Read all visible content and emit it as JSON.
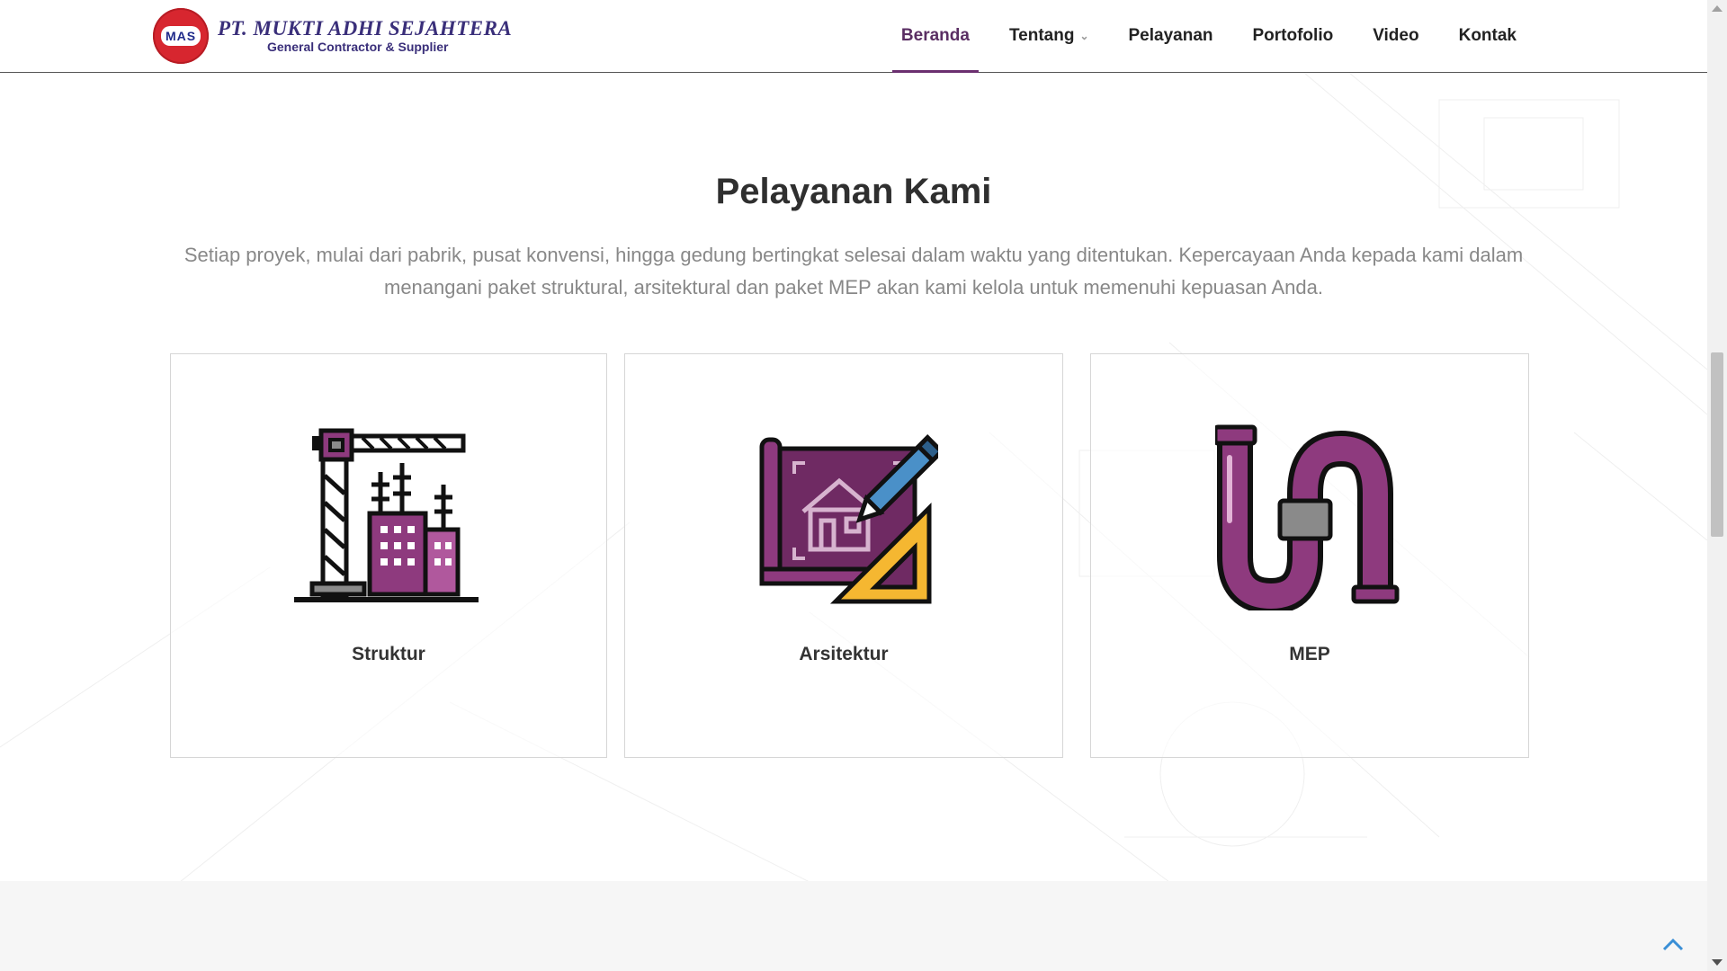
{
  "header": {
    "logo_badge": "MAS",
    "company_name": "PT. MUKTI ADHI SEJAHTERA",
    "tagline": "General Contractor & Supplier",
    "nav": [
      {
        "label": "Beranda",
        "active": true
      },
      {
        "label": "Tentang",
        "dropdown": true
      },
      {
        "label": "Pelayanan"
      },
      {
        "label": "Portofolio"
      },
      {
        "label": "Video"
      },
      {
        "label": "Kontak"
      }
    ]
  },
  "section": {
    "title": "Pelayanan Kami",
    "description": "Setiap proyek, mulai dari pabrik, pusat konvensi, hingga gedung bertingkat selesai dalam waktu yang ditentukan. Kepercayaan Anda kepada kami dalam menangani paket struktural, arsitektural dan paket MEP akan kami kelola untuk memenuhi kepuasan Anda.",
    "cards": [
      {
        "label": "Struktur",
        "icon": "crane-building-icon"
      },
      {
        "label": "Arsitektur",
        "icon": "blueprint-icon"
      },
      {
        "label": "MEP",
        "icon": "pipe-icon"
      }
    ]
  },
  "colors": {
    "accent": "#6b2f6f",
    "icon_purple": "#8e3a7e",
    "icon_light": "#b0589d",
    "icon_gray": "#8a8a8a",
    "icon_yellow": "#f5b731",
    "logo_red": "#d7262f",
    "logo_blue": "#3a2f7a"
  }
}
